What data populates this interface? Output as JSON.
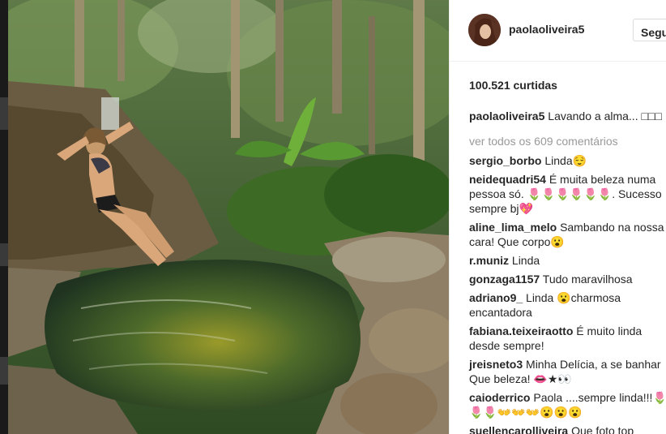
{
  "header": {
    "username": "paolaoliveira5",
    "follow_label": "Segu"
  },
  "likes": "100.521 curtidas",
  "caption": {
    "username": "paolaoliveira5",
    "text": "Lavando a alma... □□□"
  },
  "view_all": "ver todos os 609 comentários",
  "comments": [
    {
      "username": "sergio_borbo",
      "text": "Linda😌"
    },
    {
      "username": "neidequadri54",
      "text": "É muita beleza numa pessoa só. 🌷🌷🌷🌷🌷🌷. Sucesso sempre bj💖"
    },
    {
      "username": "aline_lima_melo",
      "text": "Sambando na nossa cara! Que corpo😮"
    },
    {
      "username": "r.muniz",
      "text": "Linda"
    },
    {
      "username": "gonzaga1157",
      "text": "Tudo maravilhosa"
    },
    {
      "username": "adriano9_",
      "text": "Linda 😮charmosa encantadora"
    },
    {
      "username": "fabiana.teixeiraotto",
      "text": "É muito linda desde sempre!"
    },
    {
      "username": "jreisneto3",
      "text": "Minha Delícia, a se banhar Que beleza! 👄★👀"
    },
    {
      "username": "caioderrico",
      "text": "Paola ....sempre linda!!!🌷🌷🌷👐👐👐😮😮😮"
    },
    {
      "username": "suellencarolliveira",
      "text": "Que foto top"
    }
  ],
  "colors": {
    "link_gray": "#999999",
    "text": "#262626",
    "border": "#efefef"
  }
}
